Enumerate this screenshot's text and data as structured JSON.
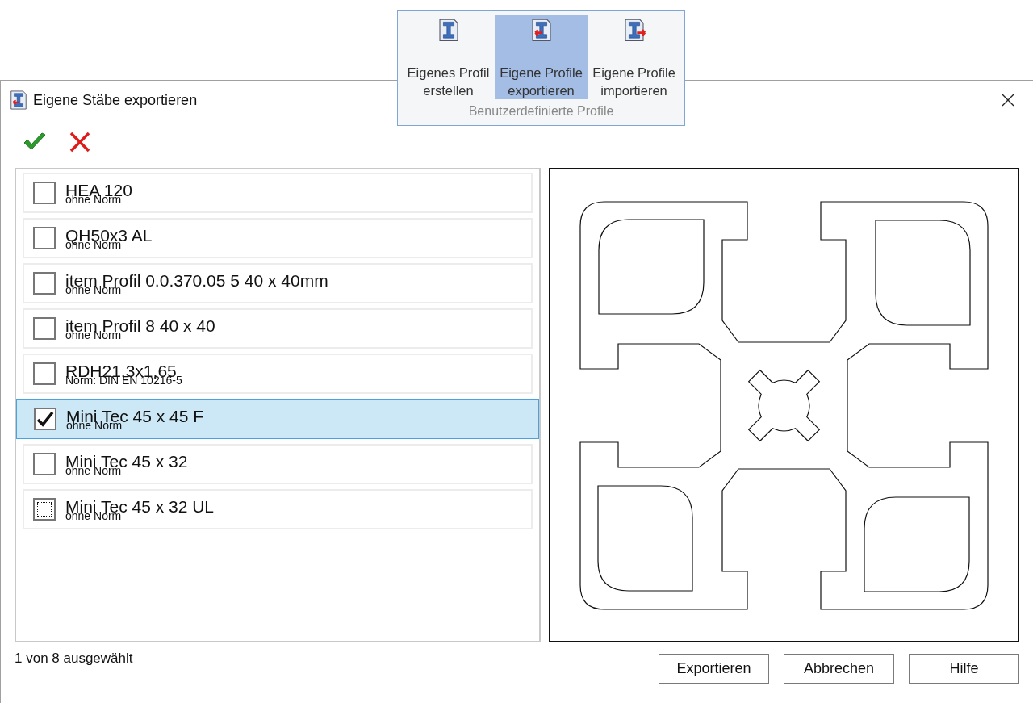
{
  "ribbon": {
    "group_label": "Benutzerdefinierte Profile",
    "buttons": [
      {
        "kind": "create",
        "lines": [
          "Eigenes Profil",
          "erstellen"
        ],
        "selected": false
      },
      {
        "kind": "export",
        "lines": [
          "Eigene Profile",
          "exportieren"
        ],
        "selected": true
      },
      {
        "kind": "import",
        "lines": [
          "Eigene Profile",
          "importieren"
        ],
        "selected": false
      }
    ]
  },
  "dialog": {
    "title": "Eigene Stäbe exportieren",
    "items": [
      {
        "name": "HEA 120",
        "norm": "ohne Norm",
        "checked": false,
        "selected": false,
        "focused": false
      },
      {
        "name": "QH50x3 AL",
        "norm": "ohne Norm",
        "checked": false,
        "selected": false,
        "focused": false
      },
      {
        "name": "item Profil 0.0.370.05 5 40 x 40mm",
        "norm": "ohne Norm",
        "checked": false,
        "selected": false,
        "focused": false
      },
      {
        "name": "item Profil 8 40 x 40",
        "norm": "ohne Norm",
        "checked": false,
        "selected": false,
        "focused": false
      },
      {
        "name": "RDH21,3x1,65",
        "norm": "Norm: DIN EN 10216-5",
        "checked": false,
        "selected": false,
        "focused": false
      },
      {
        "name": "Mini Tec 45 x 45 F",
        "norm": "ohne Norm",
        "checked": true,
        "selected": true,
        "focused": false
      },
      {
        "name": "Mini Tec 45 x 32",
        "norm": "ohne Norm",
        "checked": false,
        "selected": false,
        "focused": false
      },
      {
        "name": "Mini Tec 45 x 32 UL",
        "norm": "ohne Norm",
        "checked": false,
        "selected": false,
        "focused": true
      }
    ],
    "status": "1 von 8 ausgewählt",
    "buttons": [
      "Exportieren",
      "Abbrechen",
      "Hilfe"
    ]
  }
}
